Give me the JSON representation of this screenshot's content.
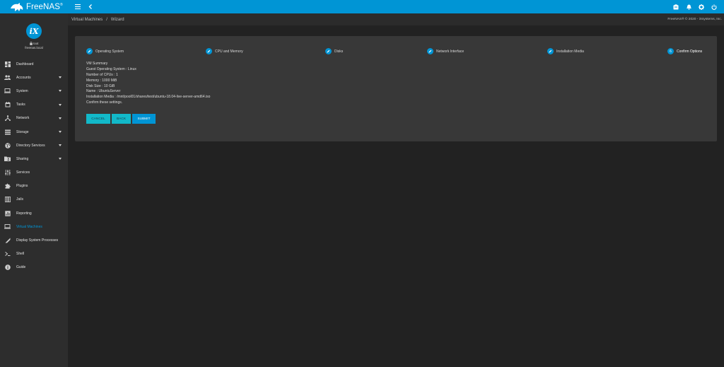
{
  "topbar": {
    "brand": "FreeNAS",
    "brand_mark": "®",
    "icons": [
      "menu-icon",
      "chevron-left-icon",
      "clipboard-icon",
      "bell-icon",
      "gear-icon",
      "power-icon"
    ]
  },
  "sidebar": {
    "logo_text": "iX",
    "user": "root",
    "host": "freenas.local",
    "items": [
      {
        "label": "Dashboard",
        "icon": "dashboard-icon",
        "has_caret": false
      },
      {
        "label": "Accounts",
        "icon": "people-icon",
        "has_caret": true
      },
      {
        "label": "System",
        "icon": "laptop-icon",
        "has_caret": true
      },
      {
        "label": "Tasks",
        "icon": "calendar-icon",
        "has_caret": true
      },
      {
        "label": "Network",
        "icon": "network-icon",
        "has_caret": true
      },
      {
        "label": "Storage",
        "icon": "storage-icon",
        "has_caret": true
      },
      {
        "label": "Directory Services",
        "icon": "globe-icon",
        "has_caret": true
      },
      {
        "label": "Sharing",
        "icon": "folder-shared-icon",
        "has_caret": true
      },
      {
        "label": "Services",
        "icon": "sliders-icon",
        "has_caret": false
      },
      {
        "label": "Plugins",
        "icon": "puzzle-icon",
        "has_caret": false
      },
      {
        "label": "Jails",
        "icon": "jail-icon",
        "has_caret": false
      },
      {
        "label": "Reporting",
        "icon": "chart-icon",
        "has_caret": false
      },
      {
        "label": "Virtual Machines",
        "icon": "computer-icon",
        "has_caret": false,
        "active": true
      },
      {
        "label": "Display System Processes",
        "icon": "processes-icon",
        "has_caret": false
      },
      {
        "label": "Shell",
        "icon": "terminal-icon",
        "has_caret": false
      },
      {
        "label": "Guide",
        "icon": "info-icon",
        "has_caret": false
      }
    ]
  },
  "breadcrumb": {
    "items": [
      "Virtual Machines",
      "Wizard"
    ],
    "separator": "/"
  },
  "copyright": "FreeNAS® © 2020 - iXsystems, Inc.",
  "wizard": {
    "steps": [
      {
        "label": "Operating System",
        "state": "done"
      },
      {
        "label": "CPU and Memory",
        "state": "done"
      },
      {
        "label": "Disks",
        "state": "done"
      },
      {
        "label": "Network Interface",
        "state": "done"
      },
      {
        "label": "Installation Media",
        "state": "done"
      },
      {
        "label": "Confirm Options",
        "state": "current",
        "number": "6"
      }
    ],
    "summary": [
      "VM Summary",
      "Guest Operating System : Linux",
      "Number of CPUs : 1",
      "Memory : 1000 MiB",
      "Disk Size : 10 GiB",
      "Name : UbuntuServer",
      "Installation Media : /mnt/pool01/shares/test/ubuntu-18.04-live-server-amd64.iso",
      "Confirm these settings."
    ],
    "buttons": {
      "cancel": "CANCEL",
      "back": "BACK",
      "submit": "SUBMIT"
    }
  },
  "colors": {
    "accent": "#0095d5",
    "teal": "#12b9c9",
    "sidebar": "#2d2d2d",
    "card": "#383838",
    "background": "#222222"
  }
}
